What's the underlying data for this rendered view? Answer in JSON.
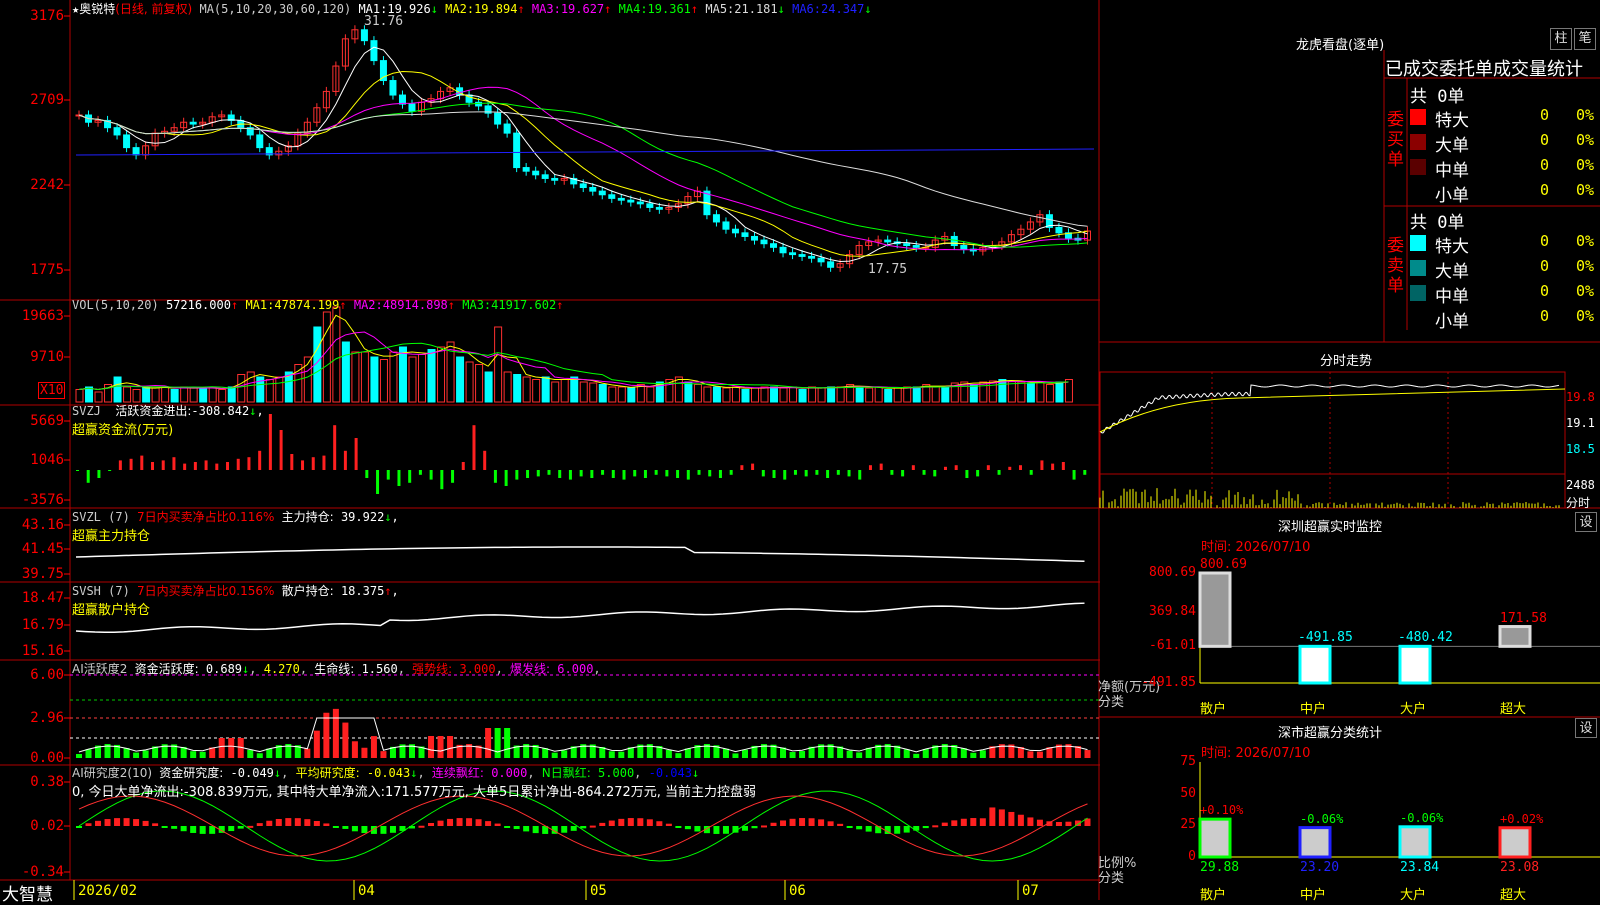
{
  "app": {
    "name": "大智慧",
    "stock": "奥锐特",
    "period": "(日线, 前复权)"
  },
  "price_panel": {
    "ma_label": "MA(5,10,20,30,60,120)",
    "ma": [
      {
        "label": "MA1:",
        "value": "19.926",
        "arrow": "↓",
        "color": "#ffffff"
      },
      {
        "label": "MA2:",
        "value": "19.894",
        "arrow": "↑",
        "color": "#ffff00"
      },
      {
        "label": "MA3:",
        "value": "19.627",
        "arrow": "↑",
        "color": "#ff00ff"
      },
      {
        "label": "MA4:",
        "value": "19.361",
        "arrow": "↑",
        "color": "#00ff00"
      },
      {
        "label": "MA5:",
        "value": "21.181",
        "arrow": "↓",
        "color": "#dcdcdc"
      },
      {
        "label": "MA6:",
        "value": "24.347",
        "arrow": "↓",
        "color": "#2020ff"
      }
    ],
    "ticks": [
      "3176",
      "2709",
      "2242",
      "1775"
    ],
    "high_label": "31.76",
    "low_label": "17.75"
  },
  "vol_panel": {
    "label": "VOL(5,10,20)",
    "value": "57216.000",
    "arrow": "↑",
    "ma": [
      {
        "label": "MA1:",
        "value": "47874.199",
        "arrow": "↑",
        "color": "#ffff00"
      },
      {
        "label": "MA2:",
        "value": "48914.898",
        "arrow": "↑",
        "color": "#ff00ff"
      },
      {
        "label": "MA3:",
        "value": "41917.602",
        "arrow": "↑",
        "color": "#00ff00"
      }
    ],
    "ticks": [
      "19663",
      "9710"
    ],
    "unit": "X10"
  },
  "svzj_panel": {
    "label": "SVZJ",
    "name": "活跃资金进出:",
    "value": "-308.842",
    "arrow": "↓",
    "suffix": ",",
    "subtitle": "超赢资金流(万元)",
    "ticks": [
      "5669",
      "1046",
      "-3576"
    ]
  },
  "svzl_panel": {
    "label": "SVZL (7)",
    "desc": "7日内买卖净占比0.116%",
    "name": "主力持仓:",
    "value": "39.922",
    "arrow": "↓",
    "suffix": ",",
    "subtitle": "超赢主力持仓",
    "ticks": [
      "43.16",
      "41.45",
      "39.75"
    ]
  },
  "svsh_panel": {
    "label": "SVSH (7)",
    "desc": "7日内买卖净占比0.156%",
    "name": "散户持仓:",
    "value": "18.375",
    "arrow": "↑",
    "suffix": ",",
    "subtitle": "超赢散户持仓",
    "ticks": [
      "18.47",
      "16.79",
      "15.16"
    ]
  },
  "ai1_panel": {
    "label": "AI活跃度2",
    "name": "资金活跃度:",
    "value": "0.689",
    "arrow": "↓",
    "v2": "4.270",
    "n3": "生命线:",
    "v3": "1.560",
    "n4": "强势线:",
    "v4": "3.000",
    "n5": "爆发线:",
    "v5": "6.000",
    "ticks": [
      "6.00",
      "2.96",
      "0.00"
    ]
  },
  "ai2_panel": {
    "label": "AI研究度2(10)",
    "name": "资金研究度:",
    "value": "-0.049",
    "arrow": "↓",
    "n2": "平均研究度:",
    "v2": "-0.043",
    "arrow2": "↓",
    "n3": "连续飘红:",
    "v3": "0.000",
    "n4": "N日飘红:",
    "v4": "5.000",
    "v5": "-0.043",
    "arrow5": "↓",
    "text": "0, 今日大单净流出:-308.839万元, 其中特大单净流入:171.577万元, 大单5日累计净出-864.272万元, 当前主力控盘弱",
    "ticks": [
      "0.38",
      "0.02",
      "-0.34"
    ]
  },
  "x_axis": {
    "labels": [
      "2026/02",
      "04",
      "05",
      "06",
      "07"
    ]
  },
  "dragon": {
    "title": "龙虎看盘(逐单)",
    "btn1": "柱",
    "btn2": "笔",
    "header": "已成交委托单成交量统计",
    "buy": {
      "label": "委买单",
      "total": "共 0单",
      "rows": [
        {
          "name": "特大",
          "val": "0",
          "pct": "0%",
          "color": "#ff0000"
        },
        {
          "name": "大单",
          "val": "0",
          "pct": "0%",
          "color": "#8b0000"
        },
        {
          "name": "中单",
          "val": "0",
          "pct": "0%",
          "color": "#5a0000"
        },
        {
          "name": "小单",
          "val": "0",
          "pct": "0%",
          "color": ""
        }
      ]
    },
    "sell": {
      "label": "委卖单",
      "total": "共 0单",
      "rows": [
        {
          "name": "特大",
          "val": "0",
          "pct": "0%",
          "color": "#00ffff"
        },
        {
          "name": "大单",
          "val": "0",
          "pct": "0%",
          "color": "#008b8b"
        },
        {
          "name": "中单",
          "val": "0",
          "pct": "0%",
          "color": "#006464"
        },
        {
          "name": "小单",
          "val": "0",
          "pct": "0%",
          "color": ""
        }
      ]
    }
  },
  "intraday": {
    "title": "分时走势",
    "ticks": [
      "19.8",
      "19.1",
      "18.5"
    ],
    "vol_tick": "2488",
    "vol_label": "分时"
  },
  "realtime": {
    "title": "深圳超赢实时监控",
    "btn": "设",
    "time": "时间: 2026/07/10",
    "ticks": [
      "800.69",
      "369.84",
      "-61.01",
      "-491.85"
    ],
    "ylabel1": "净额(万元)",
    "ylabel2": "分类",
    "bars": [
      {
        "cat": "散户",
        "value": "800.69"
      },
      {
        "cat": "中户",
        "value": "-491.85"
      },
      {
        "cat": "大户",
        "value": "-480.42"
      },
      {
        "cat": "超大",
        "value": "171.58"
      }
    ]
  },
  "classify": {
    "title": "深市超赢分类统计",
    "btn": "设",
    "time": "时间: 2026/07/10",
    "ticks": [
      "75",
      "50",
      "25",
      "0"
    ],
    "ylabel1": "比例%",
    "ylabel2": "分类",
    "bars": [
      {
        "cat": "散户",
        "pct": "+0.10%",
        "val": "29.88"
      },
      {
        "cat": "中户",
        "pct": "-0.06%",
        "val": "23.20"
      },
      {
        "cat": "大户",
        "pct": "-0.06%",
        "val": "23.84"
      },
      {
        "cat": "超大",
        "pct": "+0.02%",
        "val": "23.08"
      }
    ]
  },
  "chart_data": [
    {
      "type": "candlestick",
      "title": "奥锐特 日线 前复权",
      "y_ticks": [
        "3176",
        "2709",
        "2242",
        "1775"
      ],
      "close_approx": [
        26.3,
        25.9,
        26.0,
        25.6,
        25.2,
        24.5,
        24.1,
        24.6,
        25.3,
        25.4,
        25.6,
        25.9,
        25.8,
        25.9,
        26.2,
        26.3,
        26.0,
        25.6,
        25.2,
        24.5,
        24.1,
        24.3,
        24.6,
        25.3,
        25.9,
        26.7,
        27.6,
        29.0,
        30.5,
        31.0,
        30.4,
        29.3,
        28.2,
        27.4,
        26.9,
        26.5,
        27.0,
        27.2,
        27.6,
        27.8,
        27.4,
        27.0,
        26.8,
        26.4,
        25.8,
        25.3,
        23.4,
        23.2,
        23.0,
        22.8,
        22.7,
        22.8,
        22.5,
        22.3,
        22.1,
        21.9,
        21.7,
        21.6,
        21.5,
        21.4,
        21.2,
        21.1,
        21.2,
        21.4,
        21.8,
        22.1,
        20.8,
        20.4,
        20.0,
        19.8,
        19.6,
        19.4,
        19.2,
        19.0,
        18.7,
        18.6,
        18.5,
        18.4,
        18.2,
        17.9,
        18.1,
        18.6,
        19.1,
        19.3,
        19.4,
        19.3,
        19.2,
        19.1,
        19.0,
        19.0,
        19.4,
        19.6,
        19.1,
        18.9,
        18.8,
        19.0,
        19.1,
        19.3,
        19.7,
        20.0,
        20.4,
        20.8,
        20.1,
        19.8,
        19.5,
        19.4,
        19.9
      ],
      "high": "31.76",
      "low": "17.75"
    },
    {
      "type": "bar",
      "title": "VOL(5,10,20)",
      "y_ticks": [
        "19663",
        "9710"
      ],
      "values_approx": [
        0.25,
        0.3,
        0.2,
        0.35,
        0.5,
        0.3,
        0.25,
        0.3,
        0.28,
        0.3,
        0.25,
        0.3,
        0.28,
        0.26,
        0.3,
        0.25,
        0.3,
        0.55,
        0.6,
        0.5,
        0.45,
        0.5,
        0.6,
        0.75,
        0.9,
        1.5,
        1.8,
        1.9,
        1.2,
        1.0,
        1.0,
        0.9,
        0.85,
        1.0,
        1.1,
        0.9,
        0.95,
        1.05,
        1.1,
        1.2,
        0.9,
        0.8,
        0.75,
        0.6,
        1.5,
        0.6,
        0.55,
        0.5,
        0.45,
        0.5,
        0.4,
        0.45,
        0.5,
        0.4,
        0.38,
        0.35,
        0.3,
        0.3,
        0.28,
        0.35,
        0.3,
        0.4,
        0.45,
        0.5,
        0.4,
        0.35,
        0.3,
        0.3,
        0.28,
        0.3,
        0.25,
        0.28,
        0.3,
        0.3,
        0.28,
        0.3,
        0.25,
        0.3,
        0.28,
        0.3,
        0.3,
        0.35,
        0.3,
        0.28,
        0.3,
        0.25,
        0.28,
        0.3,
        0.3,
        0.35,
        0.3,
        0.3,
        0.38,
        0.4,
        0.35,
        0.4,
        0.42,
        0.45,
        0.42,
        0.4,
        0.38,
        0.4,
        0.35,
        0.4,
        0.45
      ]
    },
    {
      "type": "bar",
      "title": "SVZJ 活跃资金进出",
      "y_ticks": [
        "5669",
        "1046",
        "-3576"
      ],
      "values_approx": [
        0,
        -0.8,
        -0.5,
        0,
        0.6,
        0.7,
        0.9,
        0.5,
        0.6,
        0.8,
        0.4,
        0.5,
        0.6,
        0.4,
        0.5,
        0.7,
        0.8,
        1.2,
        3.5,
        2.5,
        1.0,
        0.6,
        0.8,
        0.9,
        2.8,
        1.2,
        2.0,
        -0.5,
        -1.5,
        -0.6,
        -1.0,
        -0.8,
        -0.3,
        -0.6,
        -1.2,
        -0.8,
        0.5,
        2.8,
        1.2,
        -0.8,
        -1.0,
        -0.6,
        -0.5,
        -0.4,
        -0.3,
        -0.5,
        -0.6,
        -0.4,
        -0.5,
        -0.3,
        -0.5,
        -0.6,
        -0.4,
        -0.5,
        -0.3,
        -0.4,
        -0.5,
        -0.6,
        -0.3,
        -0.4,
        -0.5,
        -0.3,
        0.3,
        0.4,
        -0.4,
        -0.5,
        -0.6,
        -0.3,
        -0.4,
        -0.3,
        -0.5,
        -0.3,
        -0.4,
        -0.6,
        0.3,
        0.4,
        -0.3,
        -0.4,
        0.3,
        -0.3,
        -0.4,
        0.2,
        0.3,
        -0.5,
        -0.4,
        0.3,
        -0.3,
        0.2,
        0.3,
        -0.3,
        0.6,
        0.4,
        0.5,
        -0.6,
        -0.3
      ]
    },
    {
      "type": "line",
      "title": "SVZL 主力持仓",
      "y_ticks": [
        "43.16",
        "41.45",
        "39.75"
      ]
    },
    {
      "type": "line",
      "title": "SVSH 散户持仓",
      "y_ticks": [
        "18.47",
        "16.79",
        "15.16"
      ]
    },
    {
      "type": "bar",
      "title": "AI活跃度2",
      "y_ticks": [
        "6.00",
        "2.96",
        "0.00"
      ],
      "lines": {
        "生命线": "1.560",
        "强势线": "3.000",
        "爆发线": "6.000"
      }
    },
    {
      "type": "bar",
      "title": "AI研究度2(10)",
      "y_ticks": [
        "0.38",
        "0.02",
        "-0.34"
      ]
    },
    {
      "type": "bar",
      "title": "深圳超赢实时监控",
      "categories": [
        "散户",
        "中户",
        "大户",
        "超大"
      ],
      "values": [
        800.69,
        -491.85,
        -480.42,
        171.58
      ],
      "ylim": [
        -491.85,
        800.69
      ]
    },
    {
      "type": "bar",
      "title": "深市超赢分类统计",
      "categories": [
        "散户",
        "中户",
        "大户",
        "超大"
      ],
      "values": [
        29.88,
        23.2,
        23.84,
        23.08
      ],
      "ylim": [
        0,
        75
      ]
    }
  ]
}
